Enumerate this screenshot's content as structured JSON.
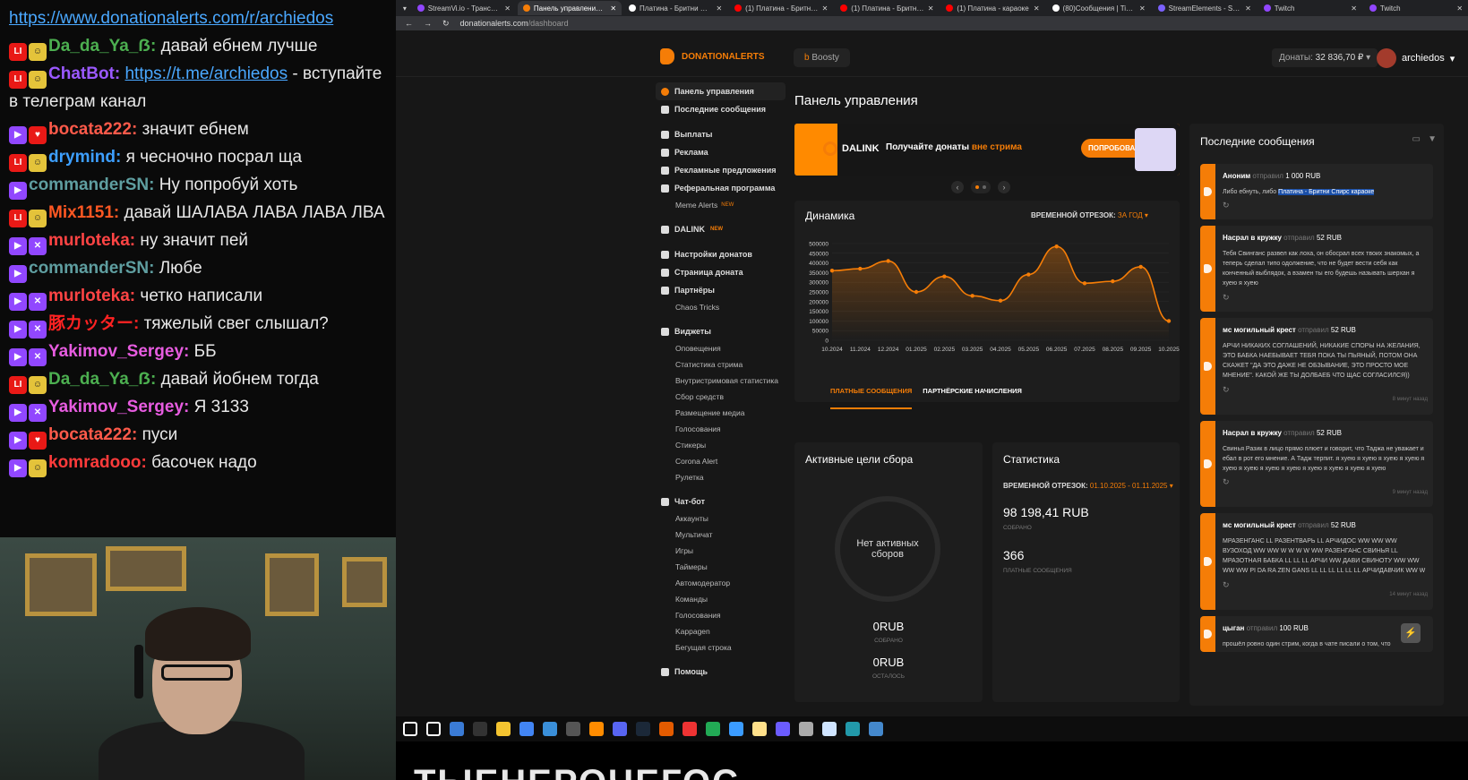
{
  "chat": {
    "top_link": "https://www.donationalerts.com/r/archiedos",
    "messages": [
      {
        "badges": [
          "live",
          "emote"
        ],
        "nick": "Da_da_Ya_ẞ:",
        "nick_color": "#4caf50",
        "text": "давай ебнем лучше"
      },
      {
        "badges": [
          "live",
          "emote"
        ],
        "nick": "ChatBot:",
        "nick_color": "#9b59ff",
        "link": "https://t.me/archiedos",
        "text": " - вступайте в телеграм канал"
      },
      {
        "badges": [
          "sub",
          "heart"
        ],
        "nick": "bocata222:",
        "nick_color": "#ff5a4a",
        "text": "значит ебнем"
      },
      {
        "badges": [
          "live",
          "emote"
        ],
        "nick": "drymind:",
        "nick_color": "#3d9fff",
        "text": "я чесночно посрал ща"
      },
      {
        "badges": [
          "sub"
        ],
        "nick": "commanderSN:",
        "nick_color": "#5f9ea0",
        "text": "Ну попробуй хоть"
      },
      {
        "badges": [
          "live",
          "emote"
        ],
        "nick": "Mix1151:",
        "nick_color": "#ff5722",
        "text": "давай ШАЛАВА ЛАВА ЛАВА ЛВА"
      },
      {
        "badges": [
          "sub",
          "mod"
        ],
        "nick": "murloteka:",
        "nick_color": "#ff4444",
        "text": "ну значит пей"
      },
      {
        "badges": [
          "sub"
        ],
        "nick": "commanderSN:",
        "nick_color": "#5f9ea0",
        "text": "Любе"
      },
      {
        "badges": [
          "sub",
          "mod"
        ],
        "nick": "murloteka:",
        "nick_color": "#ff4444",
        "text": "четко написали"
      },
      {
        "badges": [
          "sub",
          "mod"
        ],
        "nick": "豚カッター:",
        "nick_color": "#ff2222",
        "text": "тяжелый свег слышал?"
      },
      {
        "badges": [
          "sub",
          "mod"
        ],
        "nick": "Yakimov_Sergey:",
        "nick_color": "#e75ce0",
        "text": "ББ"
      },
      {
        "badges": [
          "live",
          "emote"
        ],
        "nick": "Da_da_Ya_ẞ:",
        "nick_color": "#4caf50",
        "text": "давай йобнем тогда"
      },
      {
        "badges": [
          "sub",
          "mod"
        ],
        "nick": "Yakimov_Sergey:",
        "nick_color": "#e75ce0",
        "text": "Я 3133"
      },
      {
        "badges": [
          "sub",
          "heart"
        ],
        "nick": "bocata222:",
        "nick_color": "#ff5a4a",
        "text": "пуси"
      },
      {
        "badges": [
          "sub",
          "emote"
        ],
        "nick": "komradooo:",
        "nick_color": "#ff3b3b",
        "text": "басочек надо"
      }
    ]
  },
  "browser": {
    "tabs": [
      {
        "label": "StreamVi.io - Трансляции",
        "color": "#9146ff"
      },
      {
        "label": "Панель управления - DonationAlerts",
        "color": "#f57d07"
      },
      {
        "label": "Платина - Бритни Спирс",
        "color": "#ffffff"
      },
      {
        "label": "(1) Платина - Бритни Спирс",
        "color": "#ff0000"
      },
      {
        "label": "(1) Платина - Бритни Спирс",
        "color": "#ff0000"
      },
      {
        "label": "(1) Платина - караоке",
        "color": "#ff0000"
      },
      {
        "label": "(80)Сообщения | TikTok",
        "color": "#ffffff"
      },
      {
        "label": "StreamElements - Sound",
        "color": "#7b61ff"
      },
      {
        "label": "Twitch",
        "color": "#9146ff"
      },
      {
        "label": "Twitch",
        "color": "#9146ff"
      }
    ],
    "url_host": "donationalerts.com",
    "url_path": "/dashboard"
  },
  "nav": {
    "logo": "DONATIONALERTS",
    "boosty": "Boosty",
    "donates_label": "Донаты:",
    "donates_value": "32 836,70 ₽",
    "username": "archiedos"
  },
  "sidebar": {
    "items": [
      {
        "label": "Панель управления",
        "active": true
      },
      {
        "label": "Последние сообщения"
      },
      {
        "label": "Выплаты",
        "gap": true
      },
      {
        "label": "Реклама"
      },
      {
        "label": "Рекламные предложения"
      },
      {
        "label": "Реферальная программа"
      },
      {
        "label": "Meme Alerts",
        "sub": true,
        "badge": "NEW"
      },
      {
        "label": "DALINK",
        "gap": true,
        "badge": "NEW"
      },
      {
        "label": "Настройки донатов",
        "gap": true
      },
      {
        "label": "Страница доната"
      },
      {
        "label": "Партнёры"
      },
      {
        "label": "Chaos Tricks",
        "sub": true
      },
      {
        "label": "Виджеты",
        "gap": true
      },
      {
        "label": "Оповещения",
        "sub": true
      },
      {
        "label": "Статистика стрима",
        "sub": true
      },
      {
        "label": "Внутристримовая статистика",
        "sub": true
      },
      {
        "label": "Сбор средств",
        "sub": true
      },
      {
        "label": "Размещение медиа",
        "sub": true
      },
      {
        "label": "Голосования",
        "sub": true
      },
      {
        "label": "Стикеры",
        "sub": true
      },
      {
        "label": "Corona Alert",
        "sub": true
      },
      {
        "label": "Рулетка",
        "sub": true
      },
      {
        "label": "Чат-бот",
        "gap": true
      },
      {
        "label": "Аккаунты",
        "sub": true
      },
      {
        "label": "Мультичат",
        "sub": true
      },
      {
        "label": "Игры",
        "sub": true
      },
      {
        "label": "Таймеры",
        "sub": true
      },
      {
        "label": "Автомодератор",
        "sub": true
      },
      {
        "label": "Команды",
        "sub": true
      },
      {
        "label": "Голосования",
        "sub": true
      },
      {
        "label": "Kappagen",
        "sub": true
      },
      {
        "label": "Бегущая строка",
        "sub": true
      },
      {
        "label": "Помощь",
        "gap": true
      }
    ]
  },
  "main": {
    "title": "Панель управления",
    "banner": {
      "brand": "DALINK",
      "text": "Получайте донаты ",
      "text_em": "вне стрима",
      "button": "ПОПРОБОВАТЬ"
    },
    "dynamics": {
      "title": "Динамика",
      "period_label": "ВРЕМЕННОЙ ОТРЕЗОК:",
      "period_value": "ЗА ГОД",
      "tab1": "ПЛАТНЫЕ СООБЩЕНИЯ",
      "tab2": "ПАРТНЁРСКИЕ НАЧИСЛЕНИЯ"
    },
    "goals": {
      "title": "Активные цели сбора",
      "empty": "Нет активных сборов",
      "collected_value": "0RUB",
      "collected_label": "СОБРАНО",
      "left_value": "0RUB",
      "left_label": "ОСТАЛОСЬ"
    },
    "stats": {
      "title": "Статистика",
      "period_label": "ВРЕМЕННОЙ ОТРЕЗОК:",
      "period_value": "01.10.2025 - 01.11.2025",
      "sum_value": "98 198,41 RUB",
      "sum_label": "СОБРАНО",
      "count_value": "366",
      "count_label": "ПЛАТНЫЕ СООБЩЕНИЯ"
    }
  },
  "chart_data": {
    "type": "line",
    "categories": [
      "10.2024",
      "11.2024",
      "12.2024",
      "01.2025",
      "02.2025",
      "03.2025",
      "04.2025",
      "05.2025",
      "06.2025",
      "07.2025",
      "08.2025",
      "09.2025",
      "10.2025"
    ],
    "values": [
      360000,
      370000,
      410000,
      250000,
      330000,
      230000,
      205000,
      340000,
      485000,
      295000,
      305000,
      380000,
      100000
    ],
    "yticks": [
      0,
      50000,
      100000,
      150000,
      200000,
      250000,
      300000,
      350000,
      400000,
      450000,
      500000
    ],
    "ylim": [
      0,
      500000
    ],
    "line_color": "#f57d07"
  },
  "messages": {
    "title": "Последние сообщения",
    "sent_word": "отправил",
    "items": [
      {
        "name": "Аноним",
        "amount": "1 000 RUB",
        "text": "Либо ебнуть, либо ",
        "highlight": "Платина - Бритни Спирс караоке",
        "time": ""
      },
      {
        "name": "Насрал в кружку",
        "amount": "52 RUB",
        "text": "Тебя Свинганс развел как лоха, он обосрал всех твоих знакомых, а теперь сделал типо одолжение, что не будет вести себя как конченный выблядок, а взамен ты его будешь называть шерхан я хуею я хуею",
        "time": ""
      },
      {
        "name": "мс могильный крест",
        "amount": "52 RUB",
        "text": "АРЧИ НИКАКИХ СОГЛАШЕНИЙ, НИКАКИЕ СПОРЫ НА ЖЕЛАНИЯ, ЭТО БАБКА НАЕБЫВАЕТ ТЕБЯ ПОКА ТЫ ПЬЯНЫЙ, ПОТОМ ОНА СКАЖЕТ \"ДА ЭТО ДАЖЕ НЕ ОБЗЫВАНИЕ, ЭТО ПРОСТО МОЕ МНЕНИЕ\". КАКОЙ ЖЕ ТЫ ДОЛБАЕБ ЧТО ЩАС СОГЛАСИЛСЯ))",
        "time": "8 минут назад"
      },
      {
        "name": "Насрал в кружку",
        "amount": "52 RUB",
        "text": "Свинья Разик в лицо прямо плюет и говорит, что Таджа не уважает и ебал в рот его мнение. А Тадж терпит. я хуею я хуею я хуею я хуею я хуею я хуею я хуею я хуею я хуею я хуею я хуею я хуею",
        "time": "9 минут назад"
      },
      {
        "name": "мс могильный крест",
        "amount": "52 RUB",
        "text": "МРАЗЕНГАНС LL РАЗЕНТВАРЬ LL АРЧИДОС WW WW WW ВУЗОХОД WW WW W W W W WW РАЗЕНГАНС СВИНЬЯ LL МРАЗОТНАЯ БАБКА LL LL LL АРЧИ WW ДАВИ СВИНОТУ WW WW WW WW PI DA RA ZEN GANS LL LL LL LL LL LL АРЧИДАВЧИК WW W",
        "time": "14 минут назад"
      },
      {
        "name": "цыган",
        "amount": "100 RUB",
        "text": "прошёл ровно один стрим, когда в чате писали о том, что",
        "time": ""
      }
    ]
  },
  "stream_overlay_text": "ТЫЕНЕРОЧЕГОС"
}
